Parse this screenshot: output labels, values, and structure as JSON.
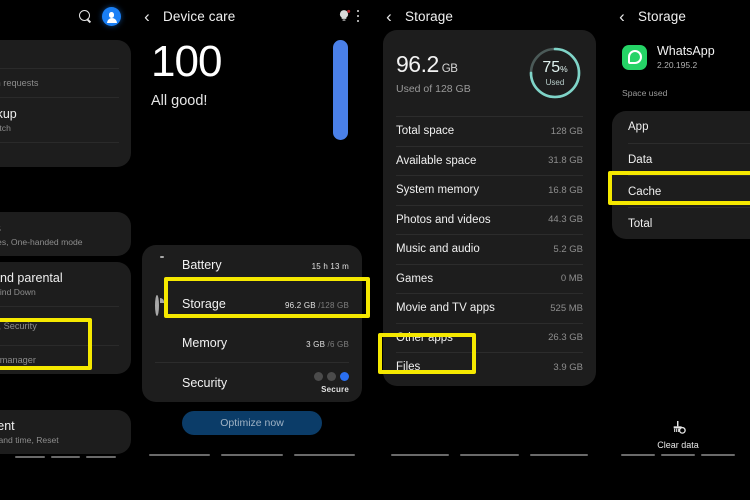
{
  "panel_settings": {
    "statusbar": {
      "search_icon": "search-icon",
      "avatar_icon": "account-avatar-icon"
    },
    "groups": [
      {
        "rows": [
          {
            "title": "",
            "subtitle": "ger"
          },
          {
            "title": "",
            "subtitle": "Location requests"
          },
          {
            "title": "d backup",
            "subtitle": "mart Switch"
          },
          {
            "title": "",
            "subtitle": ""
          }
        ]
      },
      {
        "rows": [
          {
            "title": "atures",
            "subtitle": "d gestures, One-handed mode"
          }
        ]
      },
      {
        "rows": [
          {
            "title": "eing and parental",
            "subtitle": "imers, Wind Down"
          },
          {
            "title": "",
            "subtitle": "Memory, Security"
          },
          {
            "title": "",
            "subtitle": "mission manager"
          }
        ]
      },
      {
        "rows": [
          {
            "title": "agement",
            "subtitle": "ut, Date and time, Reset"
          }
        ]
      }
    ]
  },
  "panel_device_care": {
    "header": {
      "back_icon": "back-arrow-icon",
      "title": "Device care",
      "tips_icon": "lightbulb-tips-icon",
      "overflow_icon": "more-options-icon"
    },
    "score": {
      "value": "100",
      "status": "All good!"
    },
    "items": [
      {
        "name": "Battery",
        "icon": "battery-icon",
        "value": "15 h 13 m",
        "value_dim": "",
        "bar_pct": 78,
        "type": "bar"
      },
      {
        "name": "Storage",
        "icon": "storage-icon",
        "value": "96.2 GB",
        "value_dim": "/128 GB",
        "bar_pct": 75,
        "type": "bar"
      },
      {
        "name": "Memory",
        "icon": "memory-icon",
        "value": "3 GB",
        "value_dim": "/6 GB",
        "bar_pct": 50,
        "type": "bar"
      },
      {
        "name": "Security",
        "icon": "security-icon",
        "value": "Secure",
        "value_dim": "",
        "bar_pct": 0,
        "type": "dots"
      }
    ],
    "optimize_label": "Optimize now",
    "bar_color": "#3ea34a",
    "accent_blue": "#2a6ff0"
  },
  "panel_storage": {
    "header": {
      "back_icon": "back-arrow-icon",
      "title": "Storage"
    },
    "summary": {
      "used": "96.2",
      "used_unit": "GB",
      "of_text": "Used of 128 GB",
      "ring_percent": "75",
      "ring_percent_symbol": "%",
      "ring_label": "Used",
      "ring_color": "#7fd4c8"
    },
    "items": [
      {
        "label": "Total space",
        "value": "128 GB"
      },
      {
        "label": "Available space",
        "value": "31.8 GB"
      },
      {
        "label": "System memory",
        "value": "16.8 GB"
      },
      {
        "label": "Photos and videos",
        "value": "44.3 GB"
      },
      {
        "label": "Music and audio",
        "value": "5.2 GB"
      },
      {
        "label": "Games",
        "value": "0 MB"
      },
      {
        "label": "Movie and TV apps",
        "value": "525 MB"
      },
      {
        "label": "Other apps",
        "value": "26.3 GB"
      },
      {
        "label": "Files",
        "value": "3.9 GB"
      }
    ]
  },
  "panel_app_storage": {
    "header": {
      "back_icon": "back-arrow-icon",
      "title": "Storage"
    },
    "app": {
      "name": "WhatsApp",
      "version": "2.20.195.2",
      "icon": "whatsapp-icon",
      "icon_color": "#25D366"
    },
    "section_label": "Space used",
    "items": [
      {
        "label": "App"
      },
      {
        "label": "Data"
      },
      {
        "label": "Cache"
      },
      {
        "label": "Total"
      }
    ],
    "clear_data": {
      "label": "Clear data",
      "icon": "broom-icon"
    }
  },
  "highlight_color": "#f5e800"
}
